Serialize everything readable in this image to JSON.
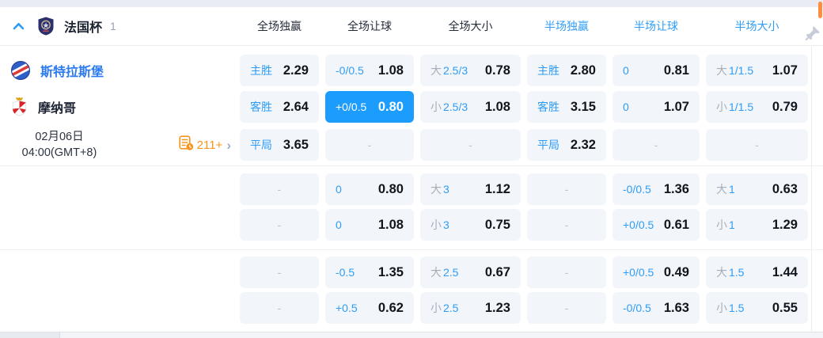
{
  "colors": {
    "accent-blue": "#2f9cf6",
    "highlight-blue": "#1c9dfe",
    "cell-bg": "#f2f6fb",
    "text-dark": "#11151d",
    "orange": "#f7941d",
    "team-blue": "#2b7af0",
    "scrollbar-orange": "#ff8e3e"
  },
  "league_header": {
    "league_name": "法国杯",
    "match_count": "1"
  },
  "columns": [
    {
      "label": "全场独赢"
    },
    {
      "label": "全场让球"
    },
    {
      "label": "全场大小"
    },
    {
      "label": "半场独赢"
    },
    {
      "label": "半场让球"
    },
    {
      "label": "半场大小"
    }
  ],
  "match": {
    "home_team": "斯特拉斯堡",
    "away_team": "摩纳哥",
    "date_line1": "02月06日",
    "date_line2": "04:00(GMT+8)",
    "more_markets": "211+"
  },
  "ui": {
    "dash": "-",
    "more_arrow": "›"
  },
  "odds": {
    "row1": {
      "c1": {
        "label": "主胜",
        "value": "2.29"
      },
      "c2": {
        "label": "-0/0.5",
        "value": "1.08"
      },
      "c3": {
        "big": "大",
        "line": "2.5/3",
        "value": "0.78"
      },
      "c4": {
        "label": "主胜",
        "value": "2.80"
      },
      "c5": {
        "label": "0",
        "value": "0.81"
      },
      "c6": {
        "big": "大",
        "line": "1/1.5",
        "value": "1.07"
      }
    },
    "row2": {
      "c1": {
        "label": "客胜",
        "value": "2.64"
      },
      "c2": {
        "label": "+0/0.5",
        "value": "0.80",
        "highlighted": true
      },
      "c3": {
        "big": "小",
        "line": "2.5/3",
        "value": "1.08"
      },
      "c4": {
        "label": "客胜",
        "value": "3.15"
      },
      "c5": {
        "label": "0",
        "value": "1.07"
      },
      "c6": {
        "big": "小",
        "line": "1/1.5",
        "value": "0.79"
      }
    },
    "row3": {
      "c1": {
        "label": "平局",
        "value": "3.65"
      },
      "c4": {
        "label": "平局",
        "value": "2.32"
      }
    },
    "row4": {
      "c2": {
        "label": "0",
        "value": "0.80"
      },
      "c3": {
        "big": "大",
        "line": "3",
        "value": "1.12"
      },
      "c5": {
        "label": "-0/0.5",
        "value": "1.36"
      },
      "c6": {
        "big": "大",
        "line": "1",
        "value": "0.63"
      }
    },
    "row5": {
      "c2": {
        "label": "0",
        "value": "1.08"
      },
      "c3": {
        "big": "小",
        "line": "3",
        "value": "0.75"
      },
      "c5": {
        "label": "+0/0.5",
        "value": "0.61"
      },
      "c6": {
        "big": "小",
        "line": "1",
        "value": "1.29"
      }
    },
    "row6": {
      "c2": {
        "label": "-0.5",
        "value": "1.35"
      },
      "c3": {
        "big": "大",
        "line": "2.5",
        "value": "0.67"
      },
      "c5": {
        "label": "+0/0.5",
        "value": "0.49"
      },
      "c6": {
        "big": "大",
        "line": "1.5",
        "value": "1.44"
      }
    },
    "row7": {
      "c2": {
        "label": "+0.5",
        "value": "0.62"
      },
      "c3": {
        "big": "小",
        "line": "2.5",
        "value": "1.23"
      },
      "c5": {
        "label": "-0/0.5",
        "value": "1.63"
      },
      "c6": {
        "big": "小",
        "line": "1.5",
        "value": "0.55"
      }
    }
  }
}
